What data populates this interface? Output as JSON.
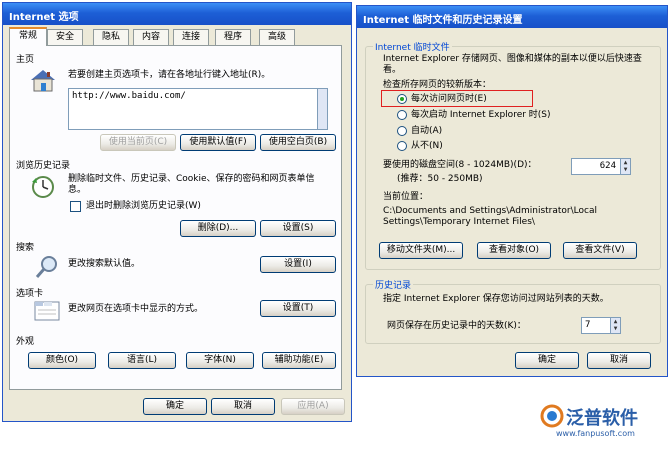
{
  "left_window": {
    "title": "Internet 选项",
    "tabs": [
      "常规",
      "安全",
      "隐私",
      "内容",
      "连接",
      "程序",
      "高级"
    ],
    "home": {
      "title": "主页",
      "desc": "若要创建主页选项卡，请在各地址行键入地址(R)。",
      "url": "http://www.baidu.com/",
      "btn_current": "使用当前页(C)",
      "btn_default": "使用默认值(F)",
      "btn_blank": "使用空白页(B)"
    },
    "history": {
      "title": "浏览历史记录",
      "desc": "删除临时文件、历史记录、Cookie、保存的密码和网页表单信息。",
      "checkbox_label": "退出时删除浏览历史记录(W)",
      "btn_delete": "删除(D)...",
      "btn_settings": "设置(S)"
    },
    "search": {
      "title": "搜索",
      "desc": "更改搜索默认值。",
      "btn_settings": "设置(I)"
    },
    "tabs_section": {
      "title": "选项卡",
      "desc": "更改网页在选项卡中显示的方式。",
      "btn_settings": "设置(T)"
    },
    "appearance": {
      "title": "外观",
      "btn_colors": "颜色(O)",
      "btn_languages": "语言(L)",
      "btn_fonts": "字体(N)",
      "btn_accessibility": "辅助功能(E)"
    },
    "footer": {
      "ok": "确定",
      "cancel": "取消",
      "apply": "应用(A)"
    }
  },
  "right_window": {
    "title": "Internet 临时文件和历史记录设置",
    "temp_files": {
      "group_title": "Internet 临时文件",
      "desc": "Internet Explorer 存储网页、图像和媒体的副本以便以后快速查看。",
      "check_label": "检查所存网页的较新版本：",
      "options": [
        "每次访问网页时(E)",
        "每次启动 Internet Explorer 时(S)",
        "自动(A)",
        "从不(N)"
      ],
      "selected_index": 0,
      "disk_label": "要使用的磁盘空间(8 - 1024MB)(D)：",
      "disk_value": "624",
      "recommend": "(推荐：50 - 250MB)",
      "location_label": "当前位置：",
      "location_line1": "C:\\Documents and Settings\\Administrator\\Local",
      "location_line2": "Settings\\Temporary Internet Files\\",
      "btn_move": "移动文件夹(M)...",
      "btn_objects": "查看对象(O)",
      "btn_files": "查看文件(V)"
    },
    "history": {
      "group_title": "历史记录",
      "desc": "指定 Internet Explorer 保存您访问过网站列表的天数。",
      "days_label": "网页保存在历史记录中的天数(K)：",
      "days_value": "7"
    },
    "footer": {
      "ok": "确定",
      "cancel": "取消"
    }
  },
  "watermark": {
    "brand": "泛普软件",
    "url": "www.fanpusoft.com"
  }
}
